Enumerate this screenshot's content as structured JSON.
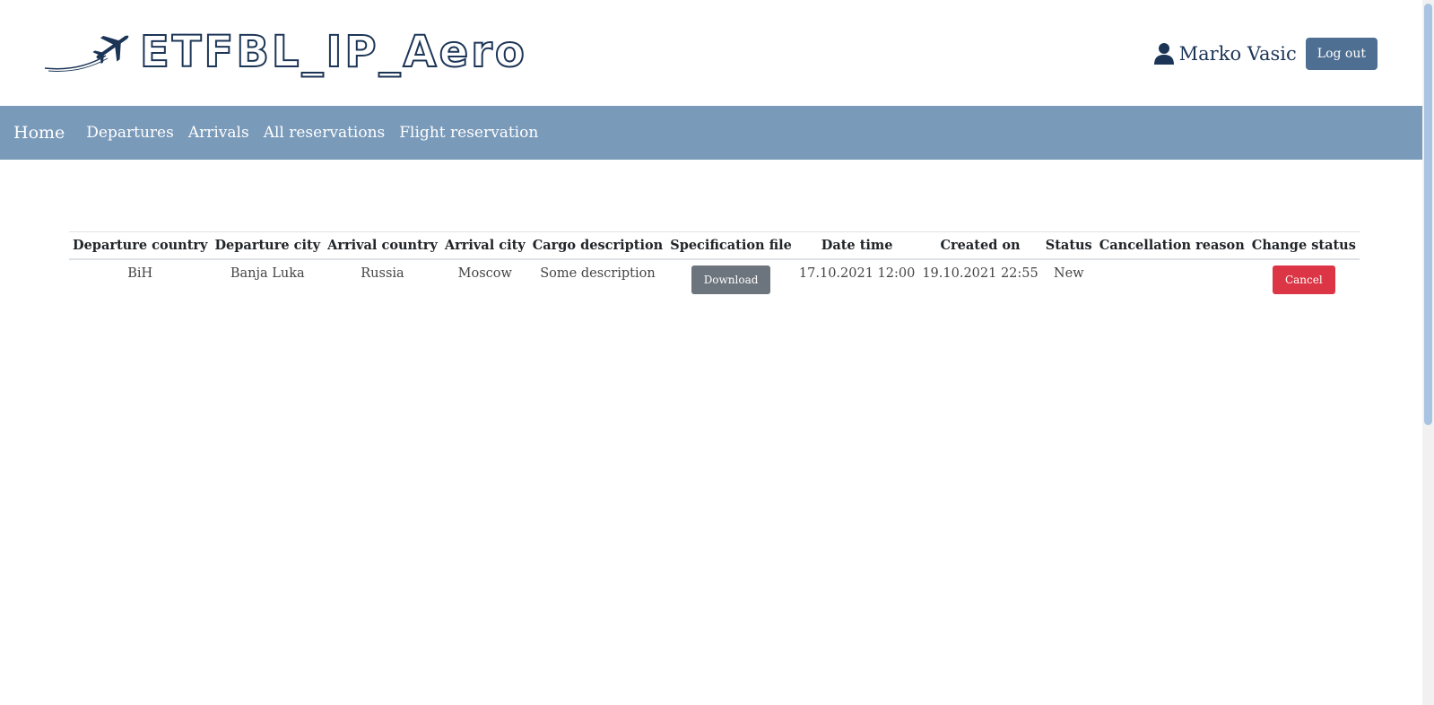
{
  "header": {
    "logo_text": "ETFBL_IP_Aero",
    "user_name": "Marko Vasic",
    "logout_label": "Log out"
  },
  "nav": {
    "home": "Home",
    "items": [
      "Departures",
      "Arrivals",
      "All reservations",
      "Flight reservation"
    ]
  },
  "table": {
    "headers": [
      "Departure country",
      "Departure city",
      "Arrival country",
      "Arrival city",
      "Cargo description",
      "Specification file",
      "Date time",
      "Created on",
      "Status",
      "Cancellation reason",
      "Change status"
    ],
    "rows": [
      {
        "departure_country": "BiH",
        "departure_city": "Banja Luka",
        "arrival_country": "Russia",
        "arrival_city": "Moscow",
        "cargo_description": "Some description",
        "spec_button": "Download",
        "date_time": "17.10.2021 12:00",
        "created_on": "19.10.2021 22:55",
        "status": "New",
        "cancellation_reason": "",
        "change_button": "Cancel"
      }
    ]
  },
  "colors": {
    "navbar": "#7a9aba",
    "logout_button": "#4e6f92",
    "download_button": "#6c757d",
    "cancel_button": "#dc3545",
    "brand": "#1c3557"
  },
  "icons": {
    "logo": "airplane-icon",
    "user": "user-icon"
  }
}
